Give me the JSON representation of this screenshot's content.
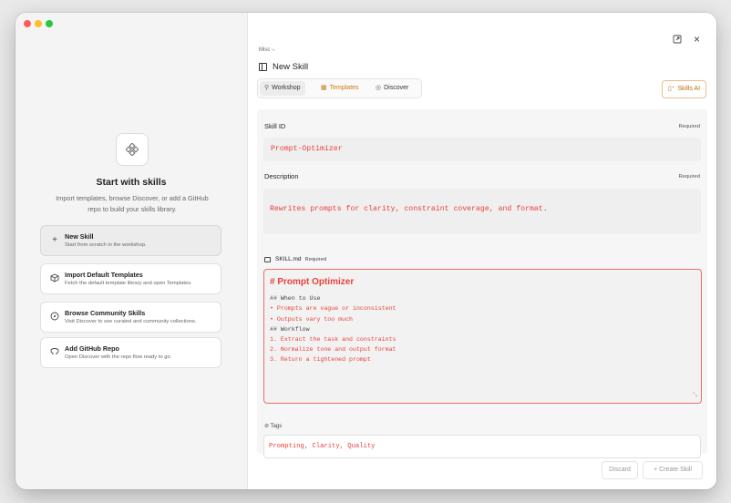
{
  "sidebar": {
    "hero_icon": "sparkle-diamond-icon",
    "title": "Start with skills",
    "description": "Import templates, browse Discover, or add a GitHub repo to build your skills library.",
    "options": [
      {
        "icon": "plus-icon",
        "title": "New Skill",
        "desc": "Start from scratch in the workshop."
      },
      {
        "icon": "package-icon",
        "title": "Import Default Templates",
        "desc": "Fetch the default template library and open Templates."
      },
      {
        "icon": "compass-icon",
        "title": "Browse Community Skills",
        "desc": "Visit Discover to see curated and community collections."
      },
      {
        "icon": "github-icon",
        "title": "Add GitHub Repo",
        "desc": "Open Discover with the repo flow ready to go."
      }
    ]
  },
  "header": {
    "breadcrumb": "Misc",
    "title": "New Skill",
    "tabs": [
      {
        "icon": "workshop-icon",
        "label": "Workshop"
      },
      {
        "icon": "grid-icon",
        "label": "Templates"
      },
      {
        "icon": "compass-icon",
        "label": "Discover"
      }
    ],
    "skills_ai_label": "Skills AI"
  },
  "form": {
    "skill_id": {
      "label": "Skill ID",
      "required": "Required",
      "value": "Prompt-Optimizer"
    },
    "description": {
      "label": "Description",
      "required": "Required",
      "value": "Rewrites prompts for clarity, constraint coverage, and format."
    },
    "skill_md": {
      "label": "SKILL.md",
      "required": "Required",
      "heading": "# Prompt Optimizer",
      "lines": [
        "## When to Use",
        "• Prompts are vague or inconsistent",
        "• Outputs vary too much",
        "## Workflow",
        "1. Extract the task and constraints",
        "2. Normalize tone and output format",
        "3. Return a tightened prompt"
      ]
    },
    "tags": {
      "label": "Tags",
      "value": "Prompting, Clarity, Quality"
    }
  },
  "footer": {
    "discard_label": "Discard",
    "create_label": "+ Create Skill"
  },
  "colors": {
    "accent_orange": "#c87a12",
    "error_red": "#e8423a"
  }
}
